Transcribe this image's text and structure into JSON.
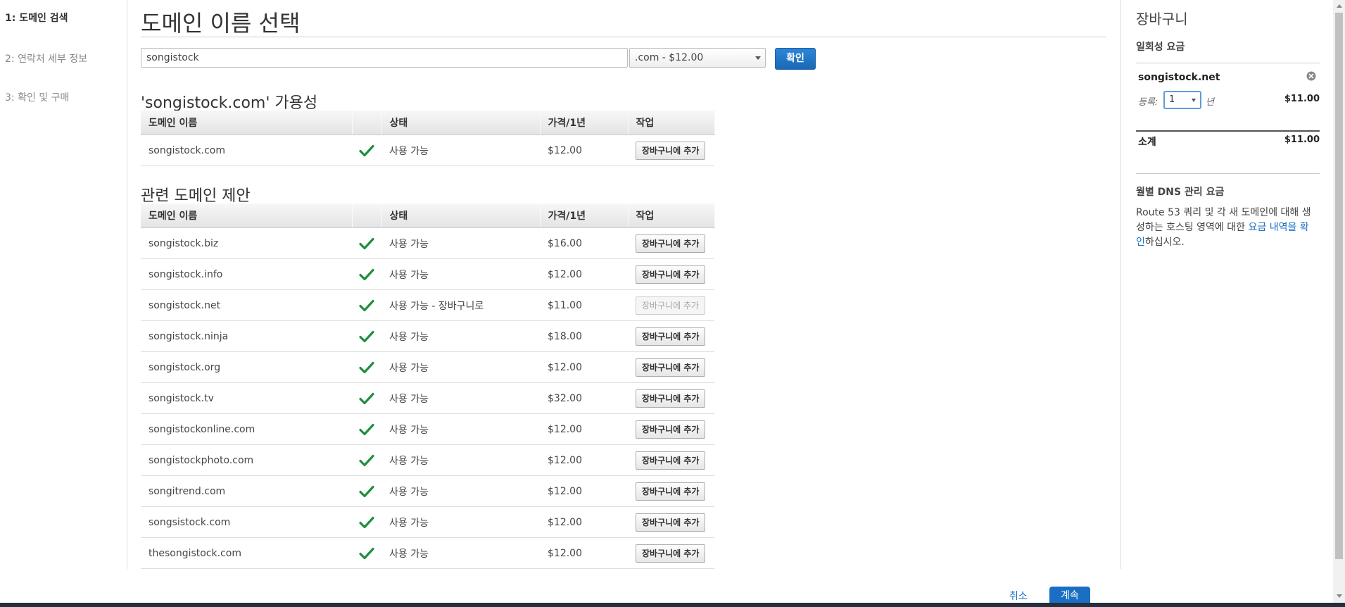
{
  "nav": {
    "steps": [
      {
        "label": "1: 도메인 검색",
        "active": true
      },
      {
        "label": "2: 연락처 세부 정보",
        "active": false
      },
      {
        "label": "3: 확인 및 구매",
        "active": false
      }
    ]
  },
  "main": {
    "title": "도메인 이름 선택",
    "search": {
      "value": "songistock"
    },
    "tld_select": {
      "selected": ".com - $12.00"
    },
    "check_button": "확인",
    "availability": {
      "title": "'songistock.com' 가용성",
      "headers": [
        "도메인 이름",
        "",
        "상태",
        "가격/1년",
        "작업"
      ],
      "rows": [
        {
          "domain": "songistock.com",
          "status": "사용 가능",
          "price": "$12.00",
          "action": "장바구니에 추가",
          "disabled": false
        }
      ]
    },
    "suggestions": {
      "title": "관련 도메인 제안",
      "headers": [
        "도메인 이름",
        "",
        "상태",
        "가격/1년",
        "작업"
      ],
      "rows": [
        {
          "domain": "songistock.biz",
          "status": "사용 가능",
          "price": "$16.00",
          "action": "장바구니에 추가",
          "disabled": false
        },
        {
          "domain": "songistock.info",
          "status": "사용 가능",
          "price": "$12.00",
          "action": "장바구니에 추가",
          "disabled": false
        },
        {
          "domain": "songistock.net",
          "status": "사용 가능 - 장바구니로",
          "price": "$11.00",
          "action": "장바구니에 추가",
          "disabled": true
        },
        {
          "domain": "songistock.ninja",
          "status": "사용 가능",
          "price": "$18.00",
          "action": "장바구니에 추가",
          "disabled": false
        },
        {
          "domain": "songistock.org",
          "status": "사용 가능",
          "price": "$12.00",
          "action": "장바구니에 추가",
          "disabled": false
        },
        {
          "domain": "songistock.tv",
          "status": "사용 가능",
          "price": "$32.00",
          "action": "장바구니에 추가",
          "disabled": false
        },
        {
          "domain": "songistockonline.com",
          "status": "사용 가능",
          "price": "$12.00",
          "action": "장바구니에 추가",
          "disabled": false
        },
        {
          "domain": "songistockphoto.com",
          "status": "사용 가능",
          "price": "$12.00",
          "action": "장바구니에 추가",
          "disabled": false
        },
        {
          "domain": "songitrend.com",
          "status": "사용 가능",
          "price": "$12.00",
          "action": "장바구니에 추가",
          "disabled": false
        },
        {
          "domain": "songsistock.com",
          "status": "사용 가능",
          "price": "$12.00",
          "action": "장바구니에 추가",
          "disabled": false
        },
        {
          "domain": "thesongistock.com",
          "status": "사용 가능",
          "price": "$12.00",
          "action": "장바구니에 추가",
          "disabled": false
        }
      ]
    }
  },
  "cart": {
    "title": "장바구니",
    "one_time_label": "일회성 요금",
    "item": {
      "name": "songistock.net",
      "reg_label": "등록:",
      "years": "1",
      "year_unit": "년",
      "price": "$11.00"
    },
    "subtotal_label": "소계",
    "subtotal": "$11.00",
    "dns_title": "월별 DNS 관리 요금",
    "dns_text_before": "Route 53 쿼리 및 각 새 도메인에 대해 생성하는 호스팅 영역에 대한 ",
    "dns_link": "요금 내역을 확인",
    "dns_text_after": "하십시오."
  },
  "footer": {
    "cancel": "취소",
    "continue": "계속"
  },
  "colors": {
    "primary": "#1a6fc2",
    "check": "#1e8e3e",
    "bottom_bar": "#232f3e"
  },
  "icons": [
    "check-icon",
    "remove-icon",
    "chevron-down-icon"
  ]
}
